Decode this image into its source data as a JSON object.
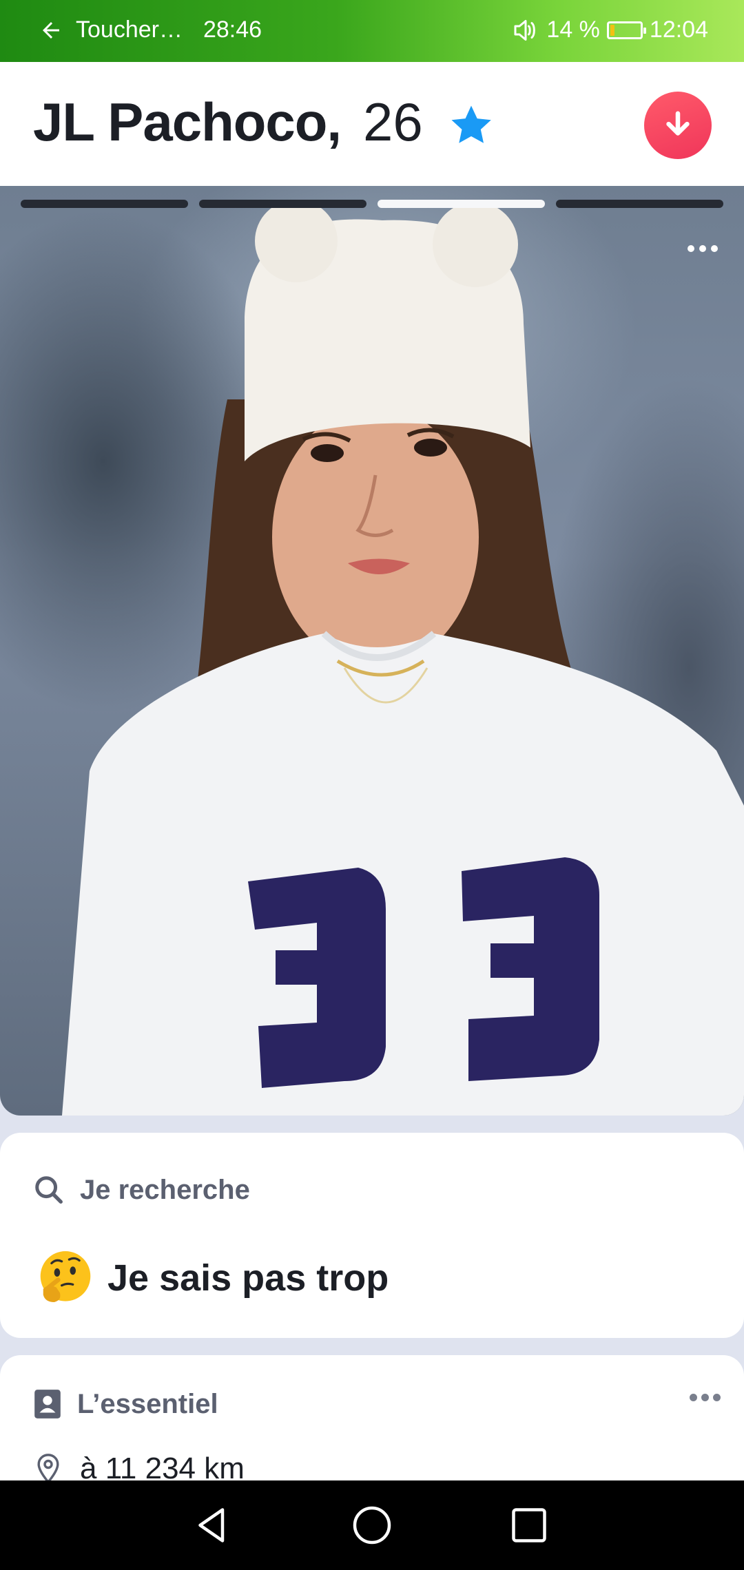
{
  "status_bar": {
    "app_label": "Toucher…",
    "timer": "28:46",
    "battery": "14 %",
    "battery_level": 0.14,
    "clock": "12:04"
  },
  "profile": {
    "name": "JL Pachoco,",
    "age": "26",
    "verified_icon": "star-icon",
    "photo_count": 4,
    "active_photo_index": 2
  },
  "looking_for": {
    "header": "Je recherche",
    "value": "Je sais pas trop",
    "emoji": "thinking-face"
  },
  "essentials": {
    "header": "L’essentiel",
    "distance": "à 11 234 km"
  },
  "colors": {
    "accent": "#f0365a",
    "star": "#1a9af5",
    "status_bar": "#3aa61c"
  }
}
